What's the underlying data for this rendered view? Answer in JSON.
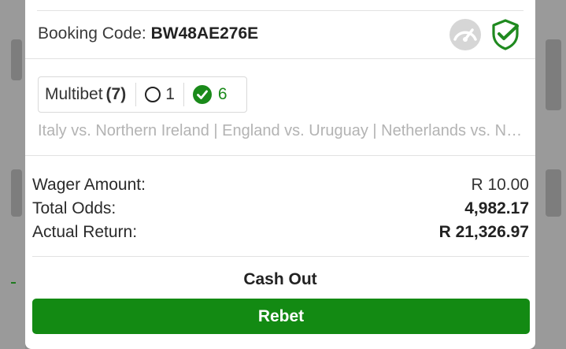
{
  "booking": {
    "label": "Booking Code:",
    "code": "BW48AE276E",
    "gauge_icon": "gauge-icon",
    "shield_icon": "shield-check-icon"
  },
  "bet": {
    "type_label": "Multibet",
    "type_count": "(7)",
    "open_count": "1",
    "won_count": "6",
    "matches": "Italy vs. Northern Ireland | England vs. Uruguay | Netherlands vs. Northern Ireland"
  },
  "summary": {
    "wager_label": "Wager Amount:",
    "wager_value": "R 10.00",
    "odds_label": "Total Odds:",
    "odds_value": "4,982.17",
    "return_label": "Actual Return:",
    "return_value": "R 21,326.97"
  },
  "actions": {
    "cashout_label": "Cash Out",
    "rebet_label": "Rebet"
  },
  "colors": {
    "accent_green": "#138a13",
    "won_green": "#1a8a1a"
  }
}
